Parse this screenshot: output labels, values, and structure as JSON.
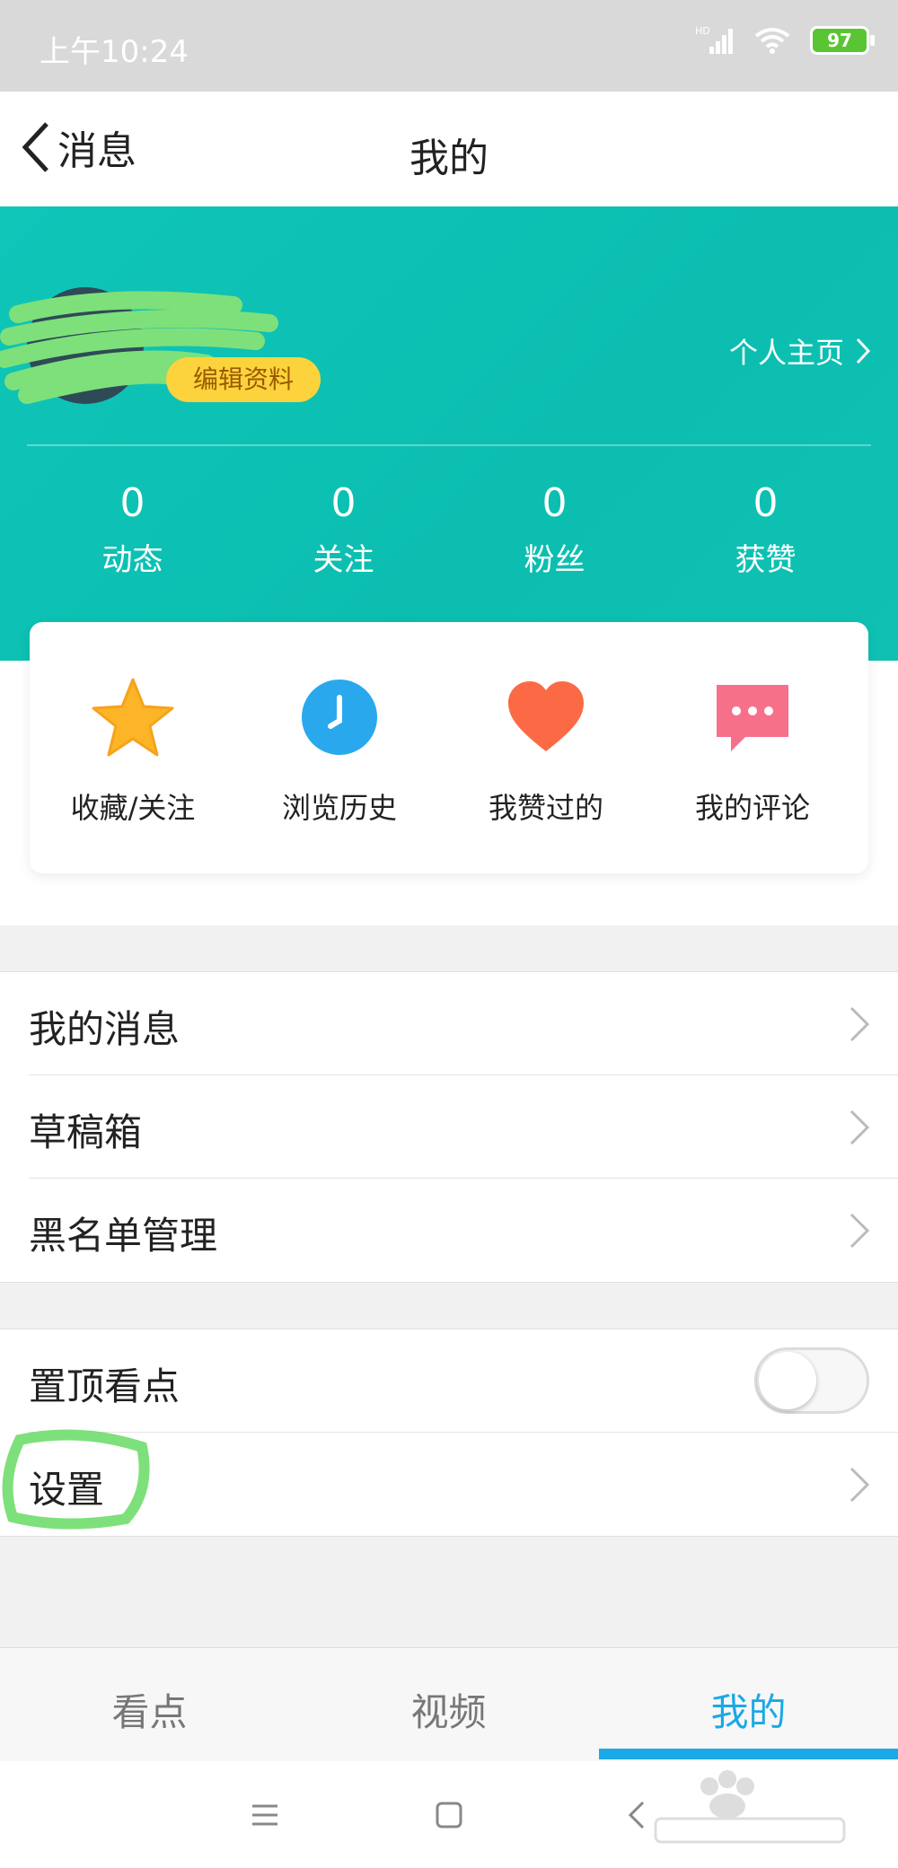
{
  "status_bar": {
    "time": "上午10:24",
    "network_label": "HD",
    "battery_level": "97"
  },
  "header": {
    "back_label": "消息",
    "title": "我的"
  },
  "profile": {
    "edit_label": "编辑资料",
    "homepage_label": "个人主页",
    "stats": [
      {
        "value": "0",
        "label": "动态"
      },
      {
        "value": "0",
        "label": "关注"
      },
      {
        "value": "0",
        "label": "粉丝"
      },
      {
        "value": "0",
        "label": "获赞"
      }
    ]
  },
  "shortcuts": [
    {
      "label": "收藏/关注",
      "icon": "star-icon"
    },
    {
      "label": "浏览历史",
      "icon": "clock-icon"
    },
    {
      "label": "我赞过的",
      "icon": "heart-icon"
    },
    {
      "label": "我的评论",
      "icon": "comment-icon"
    }
  ],
  "list1": [
    {
      "label": "我的消息"
    },
    {
      "label": "草稿箱"
    },
    {
      "label": "黑名单管理"
    }
  ],
  "list2": {
    "pin_label": "置顶看点",
    "pin_enabled": false,
    "settings_label": "设置"
  },
  "tabs": [
    {
      "label": "看点",
      "active": false
    },
    {
      "label": "视频",
      "active": false
    },
    {
      "label": "我的",
      "active": true
    }
  ],
  "colors": {
    "accent": "#1aa9e6",
    "teal": "#0fc5b8",
    "edit_button": "#fcd33c",
    "annotation": "#7ee07a"
  }
}
